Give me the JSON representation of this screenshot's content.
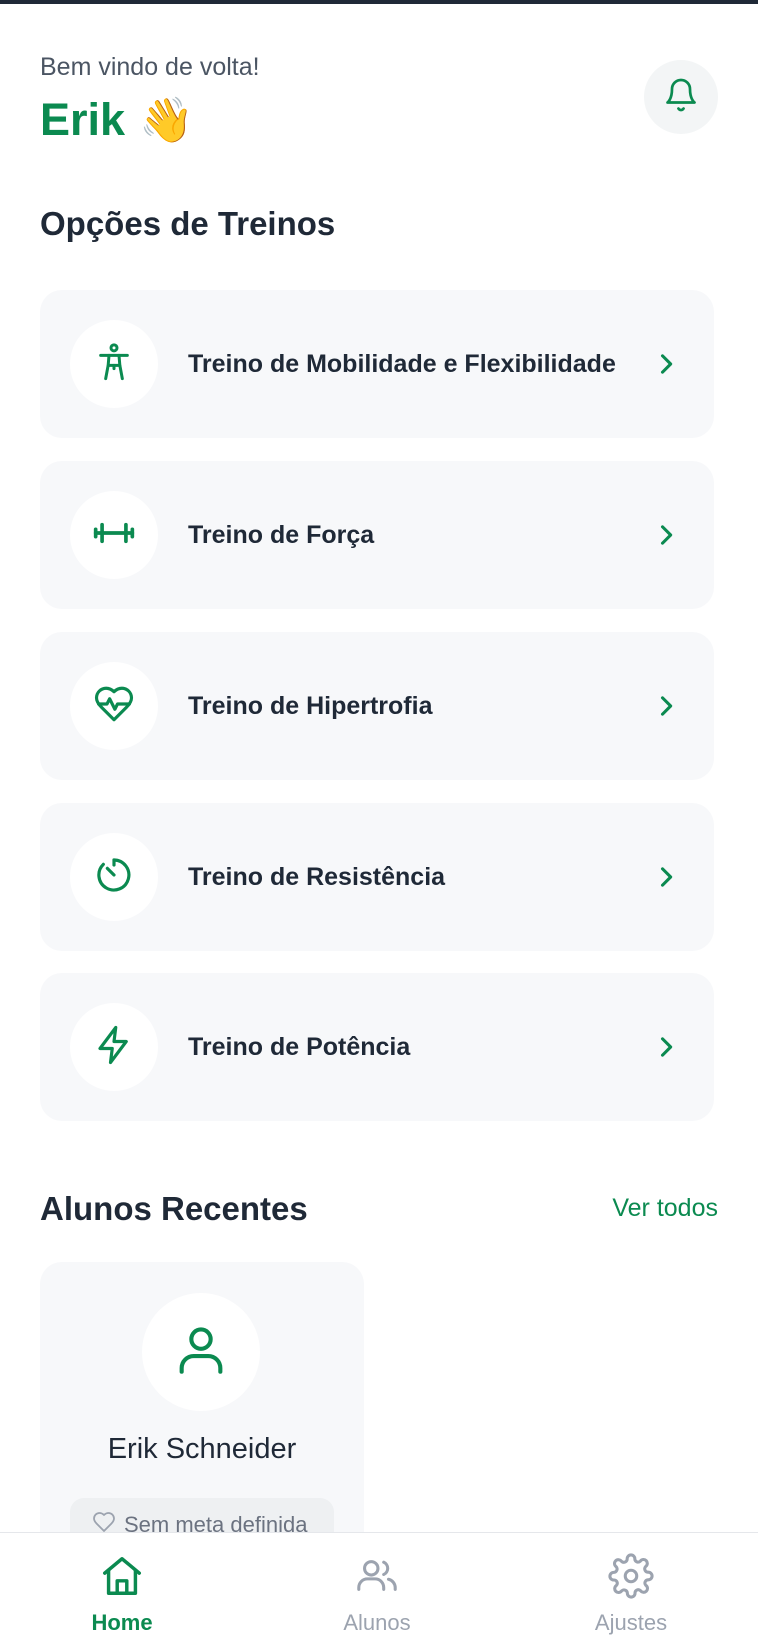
{
  "header": {
    "greeting": "Bem vindo de volta!",
    "user_name": "Erik",
    "wave_emoji": "👋",
    "notification_icon": "bell-icon"
  },
  "workouts": {
    "title": "Opções de Treinos",
    "items": [
      {
        "label": "Treino de Mobilidade e Flexibilidade",
        "icon": "person-stretch-icon"
      },
      {
        "label": "Treino de Força",
        "icon": "dumbbell-icon"
      },
      {
        "label": "Treino de Hipertrofia",
        "icon": "heart-pulse-icon"
      },
      {
        "label": "Treino de Resistência",
        "icon": "timer-icon"
      },
      {
        "label": "Treino de Potência",
        "icon": "lightning-icon"
      }
    ]
  },
  "recent_students": {
    "title": "Alunos Recentes",
    "see_all_label": "Ver todos",
    "students": [
      {
        "name": "Erik Schneider",
        "goal": "Sem meta definida"
      }
    ]
  },
  "bottom_nav": {
    "items": [
      {
        "label": "Home",
        "icon": "home-icon",
        "active": true
      },
      {
        "label": "Alunos",
        "icon": "users-icon",
        "active": false
      },
      {
        "label": "Ajustes",
        "icon": "gear-icon",
        "active": false
      }
    ]
  },
  "colors": {
    "accent": "#0b8a50",
    "text": "#1f2937",
    "muted": "#9ca3af",
    "card_bg": "#f7f8fa"
  }
}
